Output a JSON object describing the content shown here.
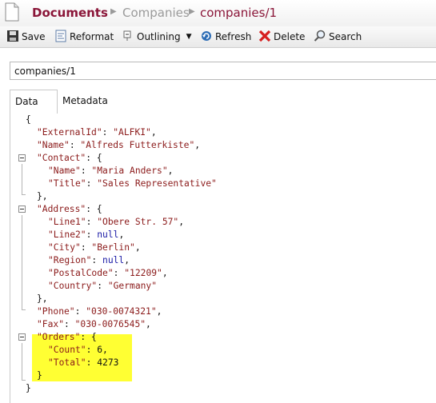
{
  "breadcrumb": {
    "root": "Documents",
    "collection": "Companies",
    "current": "companies/1"
  },
  "toolbar": {
    "save": "Save",
    "reformat": "Reformat",
    "outlining": "Outlining",
    "refresh": "Refresh",
    "delete": "Delete",
    "search": "Search"
  },
  "document_id": "companies/1",
  "tabs": {
    "data": "Data",
    "metadata": "Metadata"
  },
  "json": {
    "open_brace": "{",
    "close_brace": "}",
    "external_id_key": "\"ExternalId\"",
    "external_id_value": "\"ALFKI\"",
    "name_key": "\"Name\"",
    "name_value": "\"Alfreds Futterkiste\"",
    "contact_key": "\"Contact\"",
    "contact_name_key": "\"Name\"",
    "contact_name_value": "\"Maria Anders\"",
    "contact_title_key": "\"Title\"",
    "contact_title_value": "\"Sales Representative\"",
    "address_key": "\"Address\"",
    "line1_key": "\"Line1\"",
    "line1_value": "\"Obere Str. 57\"",
    "line2_key": "\"Line2\"",
    "line2_value": "null",
    "city_key": "\"City\"",
    "city_value": "\"Berlin\"",
    "region_key": "\"Region\"",
    "region_value": "null",
    "postal_key": "\"PostalCode\"",
    "postal_value": "\"12209\"",
    "country_key": "\"Country\"",
    "country_value": "\"Germany\"",
    "phone_key": "\"Phone\"",
    "phone_value": "\"030-0074321\"",
    "fax_key": "\"Fax\"",
    "fax_value": "\"030-0076545\"",
    "orders_key": "\"Orders\"",
    "count_key": "\"Count\"",
    "count_value": "6",
    "total_key": "\"Total\"",
    "total_value": "4273"
  },
  "colors": {
    "breadcrumb_accent": "#8a1538",
    "string": "#8b1a1a",
    "null_keyword": "#1a1aa6",
    "highlight": "#ffff33"
  },
  "icons": [
    "document-icon",
    "save-icon",
    "reformat-icon",
    "outlining-icon",
    "refresh-icon",
    "delete-icon",
    "search-icon",
    "fold-icon"
  ]
}
